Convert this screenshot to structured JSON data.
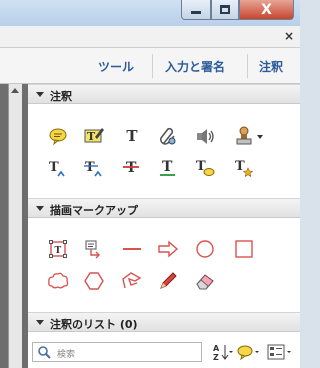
{
  "window": {
    "close_glyph": "X",
    "panel_close_glyph": "×"
  },
  "tabs": [
    {
      "label": "ツール"
    },
    {
      "label": "入力と署名"
    },
    {
      "label": "注釈"
    }
  ],
  "sections": {
    "annotations": {
      "title": "注釈",
      "tools_row1": [
        "sticky-note-icon",
        "highlight-text-icon",
        "add-text-icon",
        "attach-file-icon",
        "record-audio-icon",
        "stamp-icon"
      ],
      "tools_row2": [
        "insert-text-icon",
        "replace-text-icon",
        "strikethrough-icon",
        "underline-icon",
        "text-comment-icon",
        "text-star-icon"
      ],
      "text_tool_letter": "T"
    },
    "drawing": {
      "title": "描画マークアップ",
      "tools_row1": [
        "text-box-icon",
        "callout-icon",
        "line-icon",
        "arrow-icon",
        "oval-icon",
        "rectangle-icon"
      ],
      "tools_row2": [
        "cloud-icon",
        "polygon-icon",
        "connected-lines-icon",
        "pencil-icon",
        "eraser-icon"
      ]
    },
    "comment_list": {
      "title": "注釈のリスト (0)",
      "search_placeholder": "検索",
      "sort_icon": "sort-icon",
      "filter_icon": "comment-filter-icon",
      "options_icon": "list-options-icon",
      "sort_glyph": "A Z"
    }
  },
  "colors": {
    "accent_tab": "#2c5a9a",
    "markup_red": "#d9534f",
    "close_red": "#c8452f"
  }
}
